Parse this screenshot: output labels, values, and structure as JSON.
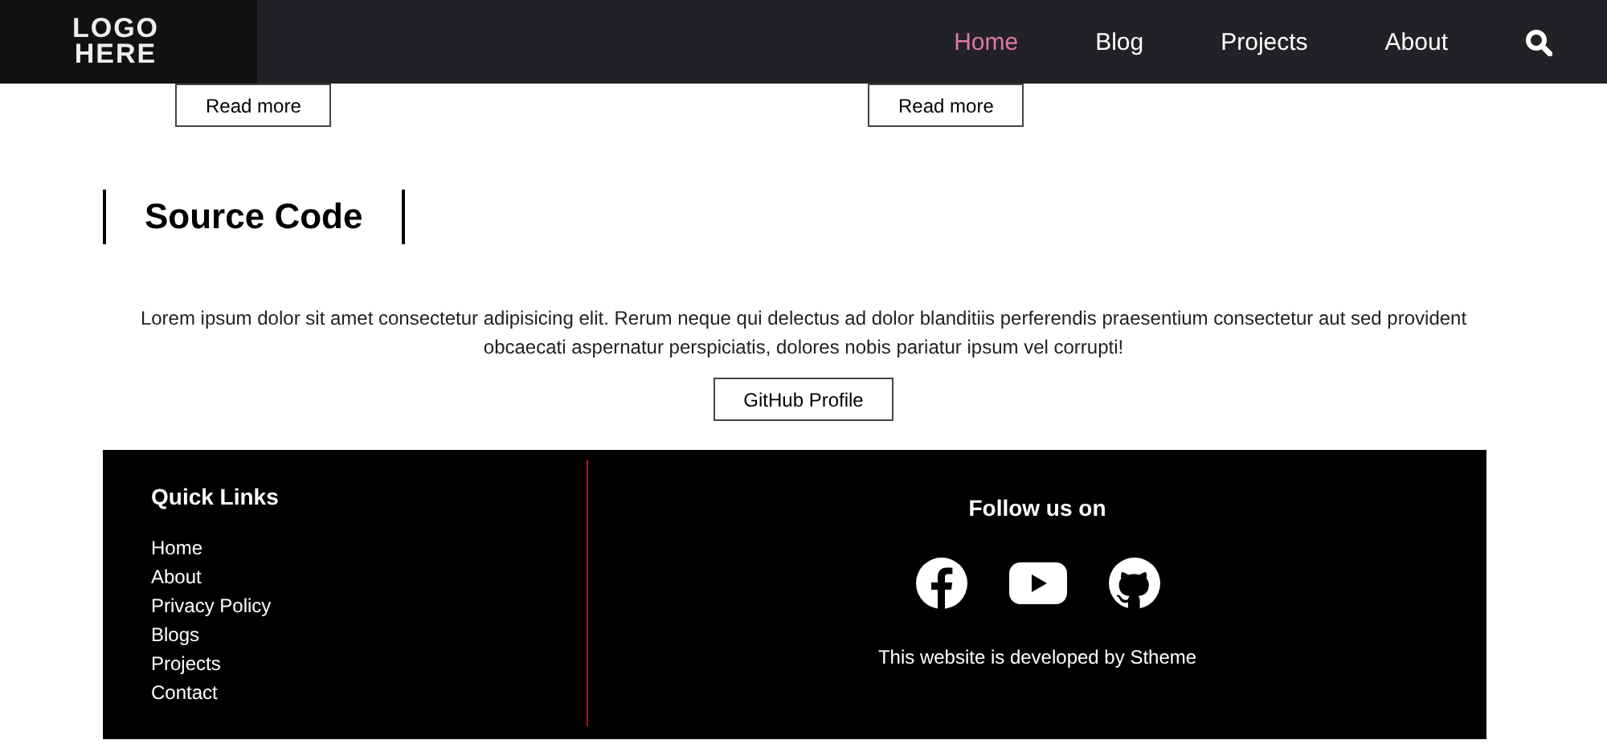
{
  "header": {
    "logo": [
      "LOGO",
      "HERE"
    ],
    "nav": [
      {
        "label": "Home",
        "selected": true
      },
      {
        "label": "Blog",
        "selected": false
      },
      {
        "label": "Projects",
        "selected": false
      },
      {
        "label": "About",
        "selected": false
      }
    ]
  },
  "cards": [
    {
      "button": "Read more"
    },
    {
      "button": "Read more"
    }
  ],
  "section": {
    "title": "Source Code",
    "text": "Lorem ipsum dolor sit amet consectetur adipisicing elit. Rerum neque qui delectus ad dolor blanditiis perferendis praesentium consectetur aut sed provident obcaecati aspernatur perspiciatis, dolores nobis pariatur ipsum vel corrupti!",
    "button": "GitHub Profile"
  },
  "footer": {
    "links_title": "Quick Links",
    "links": [
      "Home",
      "About",
      "Privacy Policy",
      "Blogs",
      "Projects",
      "Contact"
    ],
    "follow_title": "Follow us on",
    "socials": [
      {
        "kind": "facebook"
      },
      {
        "kind": "youtube"
      },
      {
        "kind": "github"
      }
    ],
    "credit": "This website is developed by Stheme"
  }
}
